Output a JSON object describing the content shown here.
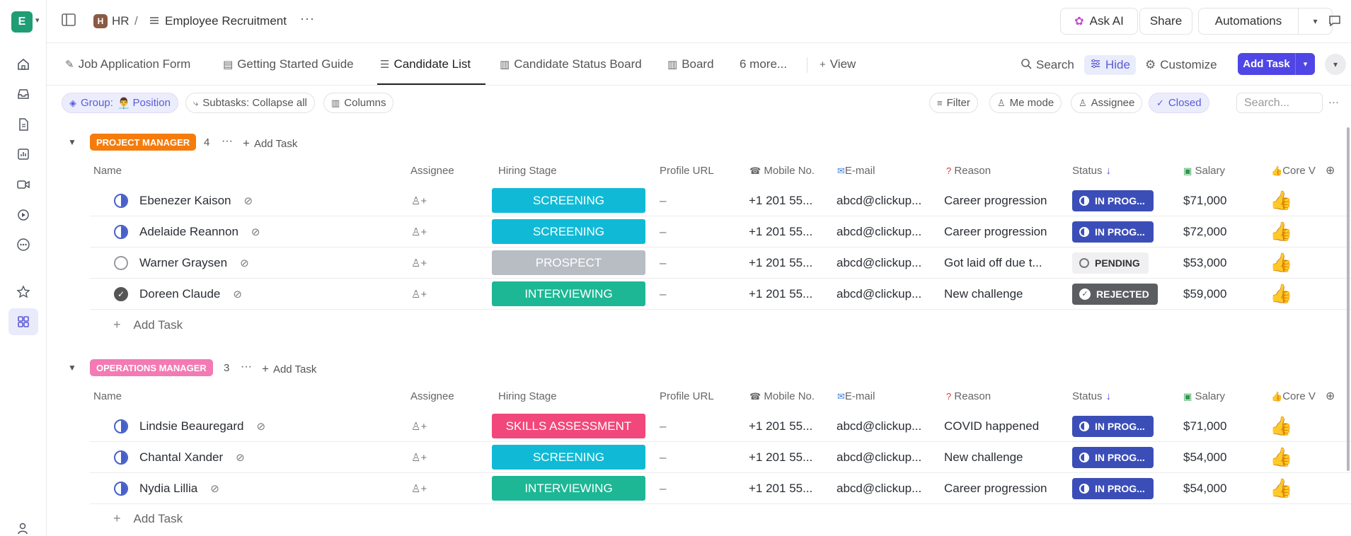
{
  "workspace": {
    "initial": "E"
  },
  "breadcrumb": {
    "space_initial": "H",
    "space": "HR",
    "separator": "/",
    "list": "Employee Recruitment",
    "more": "···"
  },
  "top_actions": {
    "ask_ai": "Ask AI",
    "share": "Share",
    "automations": "Automations"
  },
  "views": {
    "tabs": [
      {
        "label": "Job Application Form",
        "icon": "form-icon"
      },
      {
        "label": "Getting Started Guide",
        "icon": "doc-icon"
      },
      {
        "label": "Candidate List",
        "icon": "list-icon",
        "active": true
      },
      {
        "label": "Candidate Status Board",
        "icon": "board-icon"
      },
      {
        "label": "Board",
        "icon": "board-icon"
      },
      {
        "label": "6 more..."
      }
    ],
    "add_view": "View",
    "search": "Search",
    "hide": "Hide",
    "customize": "Customize",
    "add_task": "Add Task"
  },
  "filters": {
    "group_prefix": "Group:",
    "group_value": "Position",
    "subtasks": "Subtasks: Collapse all",
    "columns": "Columns",
    "filter": "Filter",
    "me_mode": "Me mode",
    "assignee": "Assignee",
    "closed": "Closed",
    "search_placeholder": "Search..."
  },
  "columns": {
    "name": "Name",
    "assignee": "Assignee",
    "hiring_stage": "Hiring Stage",
    "profile_url": "Profile URL",
    "mobile": "Mobile No.",
    "email": "E-mail",
    "reason": "Reason",
    "status": "Status",
    "salary": "Salary",
    "core": "Core V"
  },
  "groups": [
    {
      "label": "PROJECT MANAGER",
      "color": "#f57c0c",
      "count": "4",
      "add_task": "Add Task",
      "rows": [
        {
          "name": "Ebenezer Kaison",
          "state": "half",
          "stage": "SCREENING",
          "stage_color": "#10bad6",
          "profile": "–",
          "mobile": "+1 201 55...",
          "email": "abcd@clickup...",
          "reason": "Career progression",
          "status": "IN PROG...",
          "status_type": "progress",
          "salary": "$71,000"
        },
        {
          "name": "Adelaide Reannon",
          "state": "half",
          "stage": "SCREENING",
          "stage_color": "#10bad6",
          "profile": "–",
          "mobile": "+1 201 55...",
          "email": "abcd@clickup...",
          "reason": "Career progression",
          "status": "IN PROG...",
          "status_type": "progress",
          "salary": "$72,000"
        },
        {
          "name": "Warner Graysen",
          "state": "empty",
          "stage": "PROSPECT",
          "stage_color": "#b8bcc3",
          "profile": "–",
          "mobile": "+1 201 55...",
          "email": "abcd@clickup...",
          "reason": "Got laid off due t...",
          "status": "PENDING",
          "status_type": "pending",
          "salary": "$53,000"
        },
        {
          "name": "Doreen Claude",
          "state": "done",
          "stage": "INTERVIEWING",
          "stage_color": "#1db795",
          "profile": "–",
          "mobile": "+1 201 55...",
          "email": "abcd@clickup...",
          "reason": "New challenge",
          "status": "REJECTED",
          "status_type": "rejected",
          "salary": "$59,000"
        }
      ]
    },
    {
      "label": "OPERATIONS MANAGER",
      "color": "#f37ab3",
      "count": "3",
      "add_task": "Add Task",
      "rows": [
        {
          "name": "Lindsie Beauregard",
          "state": "half",
          "stage": "SKILLS ASSESSMENT",
          "stage_color": "#f2477a",
          "profile": "–",
          "mobile": "+1 201 55...",
          "email": "abcd@clickup...",
          "reason": "COVID happened",
          "status": "IN PROG...",
          "status_type": "progress",
          "salary": "$71,000"
        },
        {
          "name": "Chantal Xander",
          "state": "half",
          "stage": "SCREENING",
          "stage_color": "#10bad6",
          "profile": "–",
          "mobile": "+1 201 55...",
          "email": "abcd@clickup...",
          "reason": "New challenge",
          "status": "IN PROG...",
          "status_type": "progress",
          "salary": "$54,000"
        },
        {
          "name": "Nydia Lillia",
          "state": "half",
          "stage": "INTERVIEWING",
          "stage_color": "#1db795",
          "profile": "–",
          "mobile": "+1 201 55...",
          "email": "abcd@clickup...",
          "reason": "Career progression",
          "status": "IN PROG...",
          "status_type": "progress",
          "salary": "$54,000"
        }
      ]
    }
  ],
  "add_task_row": "Add Task",
  "status_colors": {
    "progress": "#3b4eb8",
    "rejected": "#5b5d61",
    "pending": "#f0f0f2"
  }
}
